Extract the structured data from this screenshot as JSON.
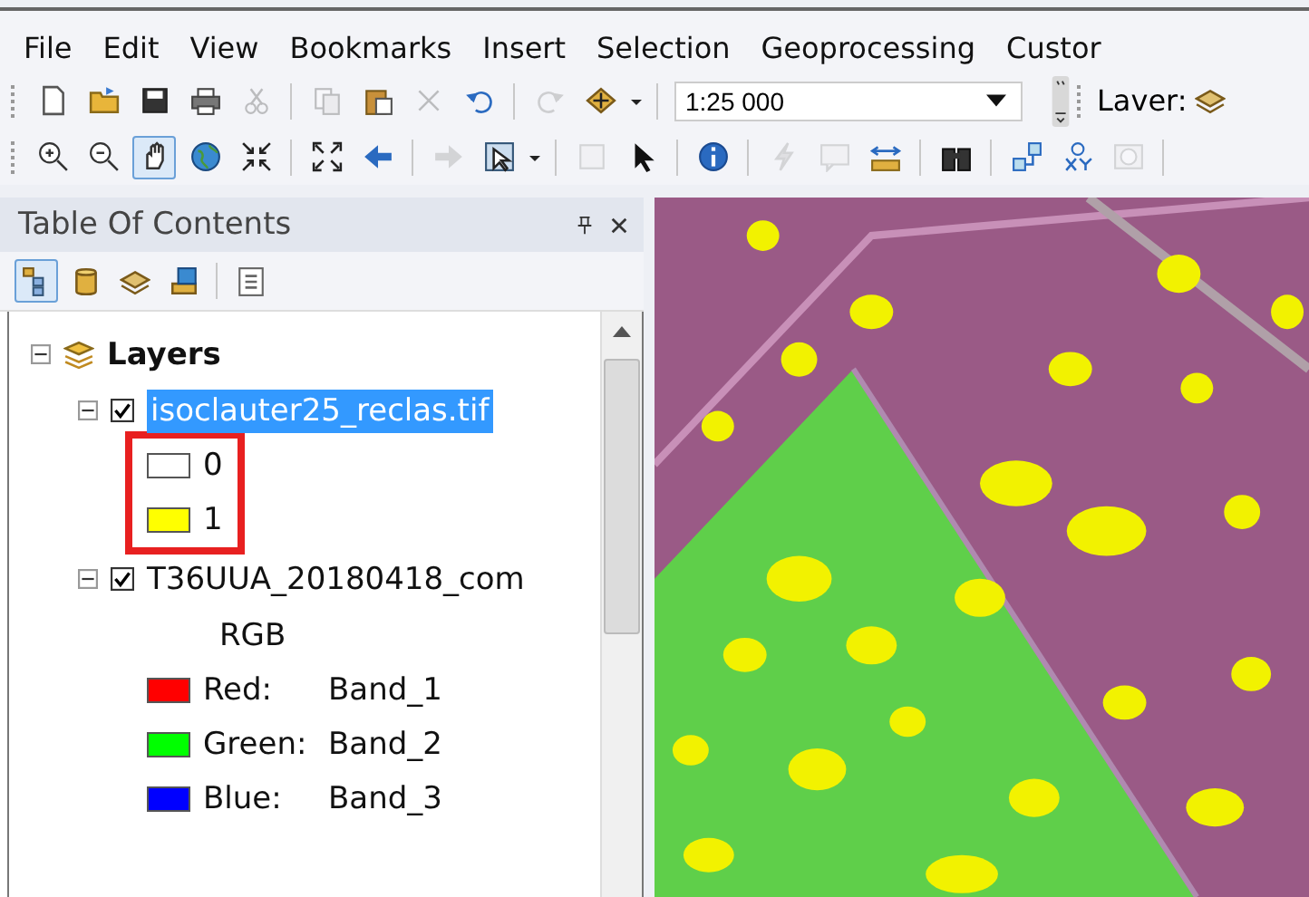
{
  "menu": [
    "File",
    "Edit",
    "View",
    "Bookmarks",
    "Insert",
    "Selection",
    "Geoprocessing",
    "Custor"
  ],
  "standard_toolbar": [
    {
      "disabled": false
    },
    {
      "disabled": false
    },
    {
      "disabled": false
    },
    {
      "disabled": false
    },
    {
      "disabled": true
    },
    {
      "disabled": true
    },
    {
      "disabled": false
    },
    {
      "disabled": true
    },
    {
      "disabled": false
    },
    {
      "disabled": true
    },
    {
      "disabled": false
    }
  ],
  "scale_field": {
    "value": "1:25 000"
  },
  "layer_label": "Laver:",
  "tools_toolbar": [
    {
      "disabled": false,
      "selected": false
    },
    {
      "disabled": false,
      "selected": false
    },
    {
      "disabled": false,
      "selected": true
    },
    {
      "disabled": false,
      "selected": false
    },
    {
      "disabled": false,
      "selected": false
    },
    {
      "disabled": false,
      "selected": false
    },
    {
      "disabled": false,
      "selected": false
    },
    {
      "disabled": true,
      "selected": false
    },
    {
      "disabled": false,
      "selected": false
    },
    {
      "disabled": true,
      "selected": false
    },
    {
      "disabled": false,
      "selected": false
    },
    {
      "disabled": false,
      "selected": false
    },
    {
      "disabled": true,
      "selected": false
    },
    {
      "disabled": true,
      "selected": false
    },
    {
      "disabled": false,
      "selected": false
    },
    {
      "disabled": false,
      "selected": false
    },
    {
      "disabled": false,
      "selected": false
    },
    {
      "disabled": false,
      "selected": false
    },
    {
      "disabled": true,
      "selected": false
    }
  ],
  "toc": {
    "title": "Table Of Contents",
    "view_buttons": [
      {
        "selected": true
      },
      {
        "selected": false
      },
      {
        "selected": false
      },
      {
        "selected": false
      },
      {
        "selected": false
      }
    ],
    "tree": {
      "label": "Layers",
      "expanded": true,
      "children": [
        {
          "label": "isoclauter25_reclas.tif",
          "checked": true,
          "selected": true,
          "expanded": true,
          "highlighted": true,
          "legend": [
            {
              "label": "0",
              "color": "#ffffff"
            },
            {
              "label": "1",
              "color": "#ffff00"
            }
          ]
        },
        {
          "label": "T36UUA_20180418_com",
          "checked": true,
          "selected": false,
          "expanded": true,
          "highlighted": false,
          "renderer": "RGB",
          "legend": [
            {
              "label": "Red:",
              "value": "Band_1",
              "color": "#ff0000"
            },
            {
              "label": "Green:",
              "value": "Band_2",
              "color": "#00ff00"
            },
            {
              "label": "Blue:",
              "value": "Band_3",
              "color": "#0000ff"
            }
          ]
        }
      ]
    }
  }
}
